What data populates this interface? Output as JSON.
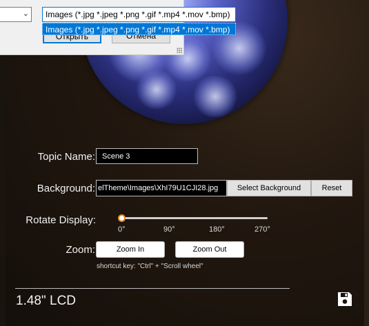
{
  "form": {
    "topic_label": "Topic Name:",
    "topic_value": "Scene 3",
    "background_label": "Background:",
    "background_path": "elTheme\\Images\\XhI79U1CJI28.jpg",
    "select_background": "Select Background",
    "reset": "Reset",
    "rotate_label": "Rotate Display:",
    "rotate_ticks": [
      "0°",
      "90°",
      "180°",
      "270°"
    ],
    "rotate_value_deg": 0,
    "zoom_label": "Zoom:",
    "zoom_in": "Zoom In",
    "zoom_out": "Zoom Out",
    "shortcut_hint": "shortcut key:  \"Ctrl\" + \"Scroll wheel\""
  },
  "footer": {
    "device_name": "1.48\" LCD",
    "save_icon": "save-icon"
  },
  "dialog": {
    "file_type_selected": "Images (*.jpg *.jpeg *.png *.gif *.mp4 *.mov *.bmp)",
    "file_type_option": "Images (*.jpg *.jpeg *.png *.gif *.mp4 *.mov *.bmp)",
    "open_button": "Открыть",
    "cancel_button": "Отмена"
  },
  "colors": {
    "accent": "#0078d7",
    "slider_thumb": "#e98a1e"
  }
}
